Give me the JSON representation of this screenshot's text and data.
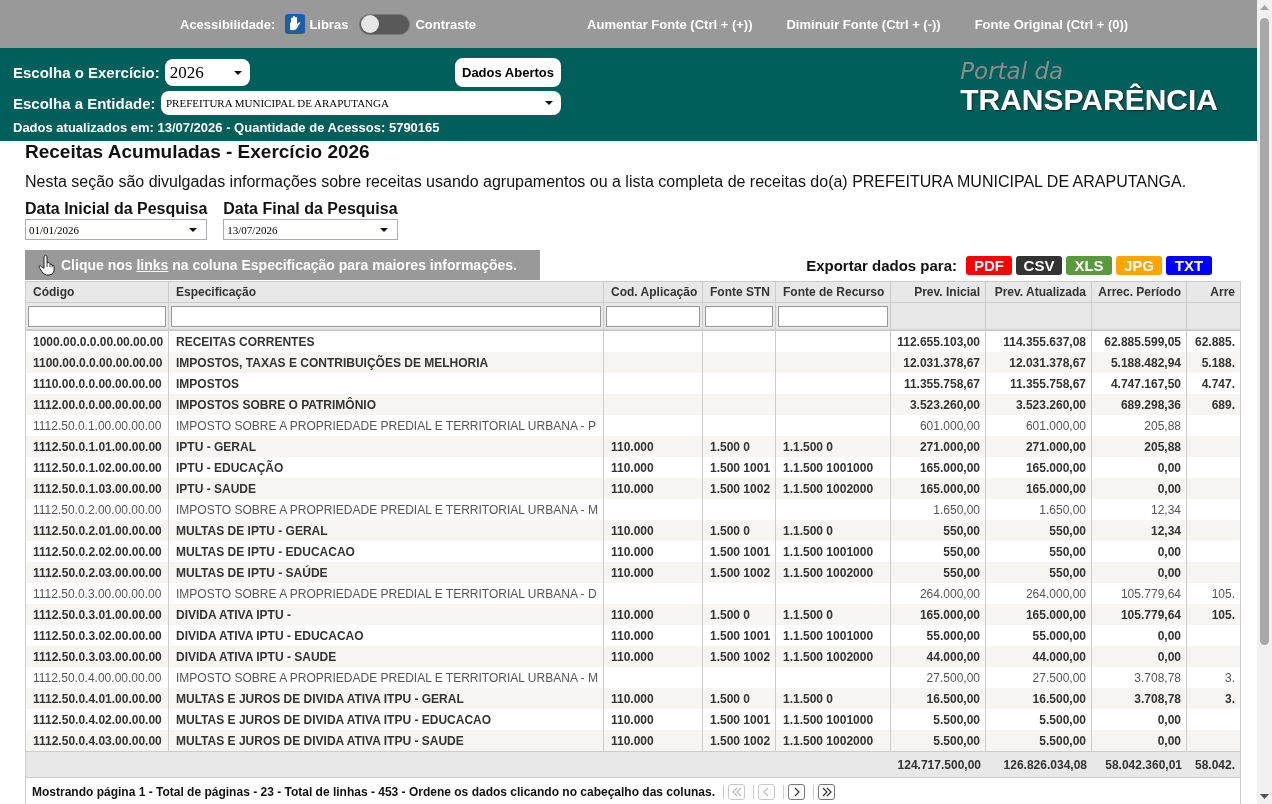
{
  "accessibility_bar": {
    "label": "Acessibilidade:",
    "libras": "Libras",
    "contrast": {
      "label": "Contraste",
      "on": false
    },
    "font_links": [
      "Aumentar Fonte (Ctrl + (+))",
      "Diminuir Fonte (Ctrl + (-))",
      "Fonte Original (Ctrl + (0))"
    ]
  },
  "header": {
    "exercise": {
      "label": "Escolha o Exercício:",
      "value": "2026"
    },
    "open_data_button": "Dados Abertos",
    "entity": {
      "label": "Escolha a Entidade:",
      "value": "PREFEITURA MUNICIPAL DE ARAPUTANGA"
    },
    "updated_info": "Dados atualizados em: 13/07/2026 - Quantidade de Acessos: 5790165",
    "logo": {
      "line_1": "Portal da",
      "line_2": "TRANSPARÊNCIA"
    }
  },
  "page": {
    "title": "Receitas Acumuladas - Exercício 2026",
    "description": "Nesta seção são divulgadas informações sobre receitas usando agrupamentos ou a lista completa de receitas do(a) PREFEITURA MUNICIPAL DE ARAPUTANGA.",
    "date_filters": [
      {
        "label": "Data Inicial da Pesquisa",
        "value": "01/01/2026"
      },
      {
        "label": "Data Final da Pesquisa",
        "value": "13/07/2026"
      }
    ],
    "hint": {
      "text_before": "Clique nos",
      "link": "links",
      "text_after": "na coluna Especificação para maiores informações."
    },
    "export": {
      "label": "Exportar dados para:",
      "formats": [
        {
          "label": "PDF",
          "color": "#ff0000"
        },
        {
          "label": "CSV",
          "color": "#333333"
        },
        {
          "label": "XLS",
          "color": "#5a9a3c"
        },
        {
          "label": "JPG",
          "color": "#ffa500"
        },
        {
          "label": "TXT",
          "color": "#0000ff"
        }
      ]
    }
  },
  "table": {
    "columns": [
      {
        "label": "Código",
        "kind": "text"
      },
      {
        "label": "Especificação",
        "kind": "text"
      },
      {
        "label": "Cod. Aplicação",
        "kind": "text"
      },
      {
        "label": "Fonte STN",
        "kind": "text"
      },
      {
        "label": "Fonte de Recurso",
        "kind": "text"
      },
      {
        "label": "Prev. Inicial",
        "kind": "number"
      },
      {
        "label": "Prev. Atualizada",
        "kind": "number"
      },
      {
        "label": "Arrec. Período",
        "kind": "number"
      },
      {
        "label": "Arre",
        "kind": "number"
      }
    ],
    "rows": [
      {
        "bold": true,
        "cells": [
          "1000.00.0.0.00.00.00.00",
          "RECEITAS CORRENTES",
          null,
          null,
          null,
          "112.655.103,00",
          "114.355.637,08",
          "62.885.599,05",
          "62.885."
        ]
      },
      {
        "bold": true,
        "cells": [
          "1100.00.0.0.00.00.00.00",
          "IMPOSTOS, TAXAS E CONTRIBUIÇÕES DE MELHORIA",
          null,
          null,
          null,
          "12.031.378,67",
          "12.031.378,67",
          "5.188.482,94",
          "5.188."
        ]
      },
      {
        "bold": true,
        "cells": [
          "1110.00.0.0.00.00.00.00",
          "IMPOSTOS",
          null,
          null,
          null,
          "11.355.758,67",
          "11.355.758,67",
          "4.747.167,50",
          "4.747."
        ]
      },
      {
        "bold": true,
        "cells": [
          "1112.00.0.0.00.00.00.00",
          "IMPOSTOS SOBRE O PATRIMÔNIO",
          null,
          null,
          null,
          "3.523.260,00",
          "3.523.260,00",
          "689.298,36",
          "689."
        ]
      },
      {
        "bold": false,
        "cells": [
          "1112.50.0.1.00.00.00.00",
          "IMPOSTO SOBRE A PROPRIEDADE PREDIAL E TERRITORIAL URBANA - P",
          null,
          null,
          null,
          "601.000,00",
          "601.000,00",
          "205,88",
          null
        ]
      },
      {
        "bold": true,
        "cells": [
          "1112.50.0.1.01.00.00.00",
          "IPTU - GERAL",
          "110.000",
          "1.500 0",
          "1.1.500 0",
          "271.000,00",
          "271.000,00",
          "205,88",
          null
        ]
      },
      {
        "bold": true,
        "cells": [
          "1112.50.0.1.02.00.00.00",
          "IPTU - EDUCAÇÃO",
          "110.000",
          "1.500 1001",
          "1.1.500 1001000",
          "165.000,00",
          "165.000,00",
          "0,00",
          null
        ]
      },
      {
        "bold": true,
        "cells": [
          "1112.50.0.1.03.00.00.00",
          "IPTU - SAUDE",
          "110.000",
          "1.500 1002",
          "1.1.500 1002000",
          "165.000,00",
          "165.000,00",
          "0,00",
          null
        ]
      },
      {
        "bold": false,
        "cells": [
          "1112.50.0.2.00.00.00.00",
          "IMPOSTO SOBRE A PROPRIEDADE PREDIAL E TERRITORIAL URBANA - M",
          null,
          null,
          null,
          "1.650,00",
          "1.650,00",
          "12,34",
          null
        ]
      },
      {
        "bold": true,
        "cells": [
          "1112.50.0.2.01.00.00.00",
          "MULTAS DE IPTU - GERAL",
          "110.000",
          "1.500 0",
          "1.1.500 0",
          "550,00",
          "550,00",
          "12,34",
          null
        ]
      },
      {
        "bold": true,
        "cells": [
          "1112.50.0.2.02.00.00.00",
          "MULTAS DE IPTU - EDUCACAO",
          "110.000",
          "1.500 1001",
          "1.1.500 1001000",
          "550,00",
          "550,00",
          "0,00",
          null
        ]
      },
      {
        "bold": true,
        "cells": [
          "1112.50.0.2.03.00.00.00",
          "MULTAS DE IPTU - SAÚDE",
          "110.000",
          "1.500 1002",
          "1.1.500 1002000",
          "550,00",
          "550,00",
          "0,00",
          null
        ]
      },
      {
        "bold": false,
        "cells": [
          "1112.50.0.3.00.00.00.00",
          "IMPOSTO SOBRE A PROPRIEDADE PREDIAL E TERRITORIAL URBANA - D",
          null,
          null,
          null,
          "264.000,00",
          "264.000,00",
          "105.779,64",
          "105."
        ]
      },
      {
        "bold": true,
        "cells": [
          "1112.50.0.3.01.00.00.00",
          "DIVIDA ATIVA IPTU -",
          "110.000",
          "1.500 0",
          "1.1.500 0",
          "165.000,00",
          "165.000,00",
          "105.779,64",
          "105."
        ]
      },
      {
        "bold": true,
        "cells": [
          "1112.50.0.3.02.00.00.00",
          "DIVIDA ATIVA IPTU - EDUCACAO",
          "110.000",
          "1.500 1001",
          "1.1.500 1001000",
          "55.000,00",
          "55.000,00",
          "0,00",
          null
        ]
      },
      {
        "bold": true,
        "cells": [
          "1112.50.0.3.03.00.00.00",
          "DIVIDA ATIVA IPTU - SAUDE",
          "110.000",
          "1.500 1002",
          "1.1.500 1002000",
          "44.000,00",
          "44.000,00",
          "0,00",
          null
        ]
      },
      {
        "bold": false,
        "cells": [
          "1112.50.0.4.00.00.00.00",
          "IMPOSTO SOBRE A PROPRIEDADE PREDIAL E TERRITORIAL URBANA - M",
          null,
          null,
          null,
          "27.500,00",
          "27.500,00",
          "3.708,78",
          "3."
        ]
      },
      {
        "bold": true,
        "cells": [
          "1112.50.0.4.01.00.00.00",
          "MULTAS E JUROS DE DIVIDA ATIVA ITPU - GERAL",
          "110.000",
          "1.500 0",
          "1.1.500 0",
          "16.500,00",
          "16.500,00",
          "3.708,78",
          "3."
        ]
      },
      {
        "bold": true,
        "cells": [
          "1112.50.0.4.02.00.00.00",
          "MULTAS E JUROS DE DIVIDA ATIVA ITPU - EDUCACAO",
          "110.000",
          "1.500 1001",
          "1.1.500 1001000",
          "5.500,00",
          "5.500,00",
          "0,00",
          null
        ]
      },
      {
        "bold": true,
        "cells": [
          "1112.50.0.4.03.00.00.00",
          "MULTAS E JUROS DE DIVIDA ATIVA ITPU - SAUDE",
          "110.000",
          "1.500 1002",
          "1.1.500 1002000",
          "5.500,00",
          "5.500,00",
          "0,00",
          null
        ]
      }
    ],
    "totals": [
      "124.717.500,00",
      "126.826.034,08",
      "58.042.360,01",
      "58.042."
    ]
  },
  "footer": {
    "summary": "Mostrando página 1 - Total de páginas - 23 - Total de linhas - 453 - Ordene os dados clicando no cabeçalho das colunas.",
    "pager": [
      {
        "kind": "first",
        "disabled": true
      },
      {
        "kind": "previous",
        "disabled": true
      },
      {
        "kind": "next",
        "disabled": false
      },
      {
        "kind": "last",
        "disabled": false
      }
    ]
  }
}
